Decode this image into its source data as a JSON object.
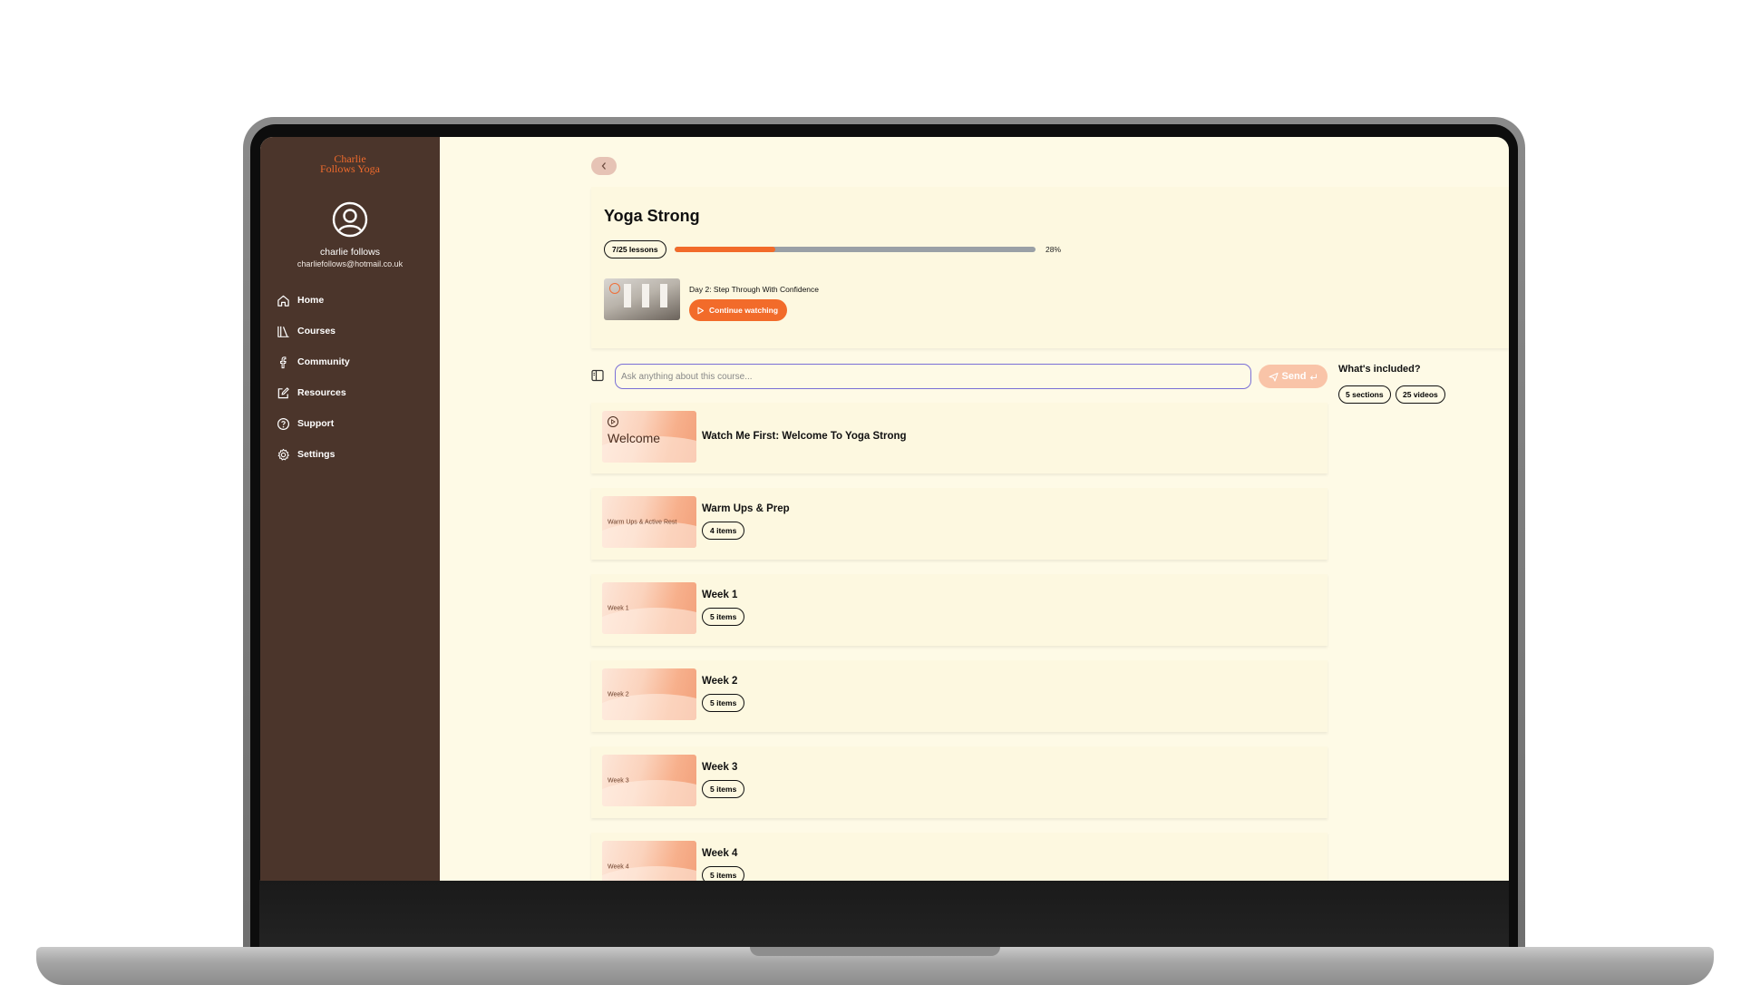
{
  "brand": {
    "logo_line1": "Charlie",
    "logo_line2": "Follows Yoga",
    "accent": "#f26b2a"
  },
  "user": {
    "name": "charlie follows",
    "email": "charliefollows@hotmail.co.uk"
  },
  "nav": [
    {
      "label": "Home",
      "icon": "home-icon"
    },
    {
      "label": "Courses",
      "icon": "books-icon"
    },
    {
      "label": "Community",
      "icon": "facebook-icon"
    },
    {
      "label": "Resources",
      "icon": "edit-icon"
    },
    {
      "label": "Support",
      "icon": "help-icon"
    },
    {
      "label": "Settings",
      "icon": "gear-icon"
    }
  ],
  "course": {
    "title": "Yoga Strong",
    "lessons_label": "7/25 lessons",
    "progress": 0.28,
    "progress_label": "28%",
    "current_lesson": "Day 2: Step Through With Confidence",
    "continue_label": "Continue watching"
  },
  "ask": {
    "placeholder": "Ask anything about this course...",
    "send_label": "Send"
  },
  "included": {
    "title": "What's included?",
    "sections_label": "5 sections",
    "videos_label": "25 videos"
  },
  "sections": [
    {
      "title": "Watch Me First: Welcome To Yoga Strong",
      "thumb": "Welcome",
      "items": ""
    },
    {
      "title": "Warm Ups & Prep",
      "thumb": "Warm Ups & Active Rest",
      "items": "4 items"
    },
    {
      "title": "Week 1",
      "thumb": "Week 1",
      "items": "5 items"
    },
    {
      "title": "Week 2",
      "thumb": "Week 2",
      "items": "5 items"
    },
    {
      "title": "Week 3",
      "thumb": "Week 3",
      "items": "5 items"
    },
    {
      "title": "Week 4",
      "thumb": "Week 4",
      "items": "5 items"
    }
  ]
}
